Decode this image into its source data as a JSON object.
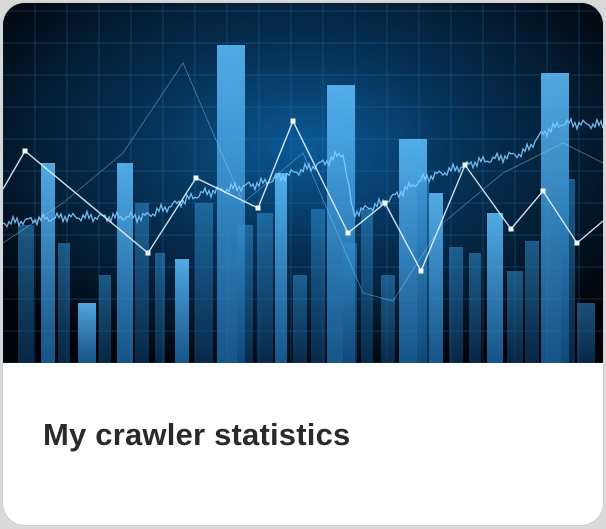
{
  "card": {
    "title": "My crawler statistics",
    "image_icon": "stock-chart-image",
    "accent_color": "#3fa7e8"
  }
}
